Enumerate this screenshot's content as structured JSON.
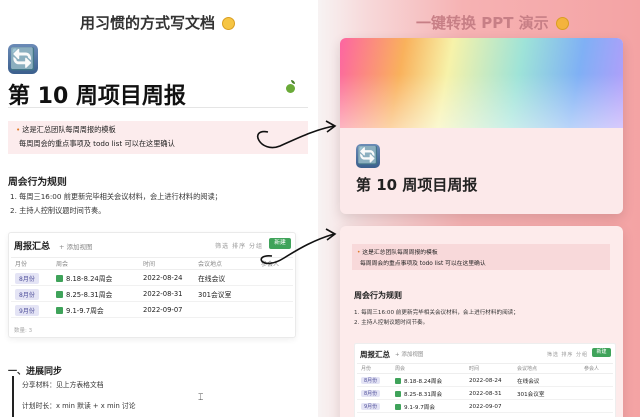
{
  "header": {
    "left_title": "用习惯的方式写文档",
    "right_title": "一键转换 PPT 演示"
  },
  "doc": {
    "page_icon": "🔄",
    "title": "第 10 周项目周报",
    "callout": {
      "line1": "这是汇总团队每周周报的模板",
      "line2": "每周周会的重点事项及 todo list 可以在这里确认"
    },
    "rules_heading": "周会行为规则",
    "rules": [
      "1. 每周三16:00 前更新完毕相关会议材料，会上进行材料的阅读；",
      "2. 主持人控制议题时间节奏。"
    ],
    "database": {
      "title": "周报汇总",
      "add_view": "+ 添加视图",
      "tools": "筛选 排序 分组",
      "new_button": "新建",
      "columns": [
        "月份",
        "周会",
        "时间",
        "会议地点",
        "参会人"
      ],
      "rows": [
        {
          "month": "8月份",
          "meeting": "8.18-8.24周会",
          "date": "2022-08-24",
          "place": "在线会议"
        },
        {
          "month": "8月份",
          "meeting": "8.25-8.31周会",
          "date": "2022-08-31",
          "place": "301会议室"
        },
        {
          "month": "9月份",
          "meeting": "9.1-9.7周会",
          "date": "2022-09-07",
          "place": ""
        }
      ],
      "footer": "数量: 3"
    },
    "progress_heading": "一、进展同步",
    "quote": {
      "line1": "分享材料：见上方表格文档",
      "line2": "计划时长：x min 默读 + x min 讨论"
    }
  },
  "ppt": {
    "slide1": {
      "icon": "🔄",
      "title": "第 10 周项目周报"
    },
    "slide2": {
      "callout_line1": "这是汇总团队每周周报的模板",
      "callout_line2": "每周周会的重点事项及 todo list 可以在这里确认",
      "heading": "周会行为规则",
      "rules": [
        "1. 每周三16:00 前更新完毕相关会议材料，会上进行材料的阅读；",
        "2. 主持人控制议题时间节奏。"
      ],
      "db_title": "周报汇总",
      "db_add": "+ 添加视图",
      "db_tools": "筛选 排序 分组",
      "db_new": "新建",
      "columns": [
        "月份",
        "周会",
        "时间",
        "会议地点",
        "参会人"
      ],
      "rows": [
        {
          "month": "8月份",
          "meeting": "8.18-8.24周会",
          "date": "2022-08-24",
          "place": "在线会议"
        },
        {
          "month": "8月份",
          "meeting": "8.25-8.31周会",
          "date": "2022-08-31",
          "place": "301会议室"
        },
        {
          "month": "9月份",
          "meeting": "9.1-9.7周会",
          "date": "2022-09-07",
          "place": ""
        }
      ]
    }
  },
  "icons": {
    "page": "sync-arrows-icon",
    "apple": "green-apple-icon",
    "sheet": "spreadsheet-icon",
    "arrow": "curved-arrow-icon"
  },
  "colors": {
    "callout_bg": "#fceced",
    "badge_bg": "#e4e4f5",
    "new_button": "#3fa35a",
    "right_bg": "#f4a3a4"
  }
}
